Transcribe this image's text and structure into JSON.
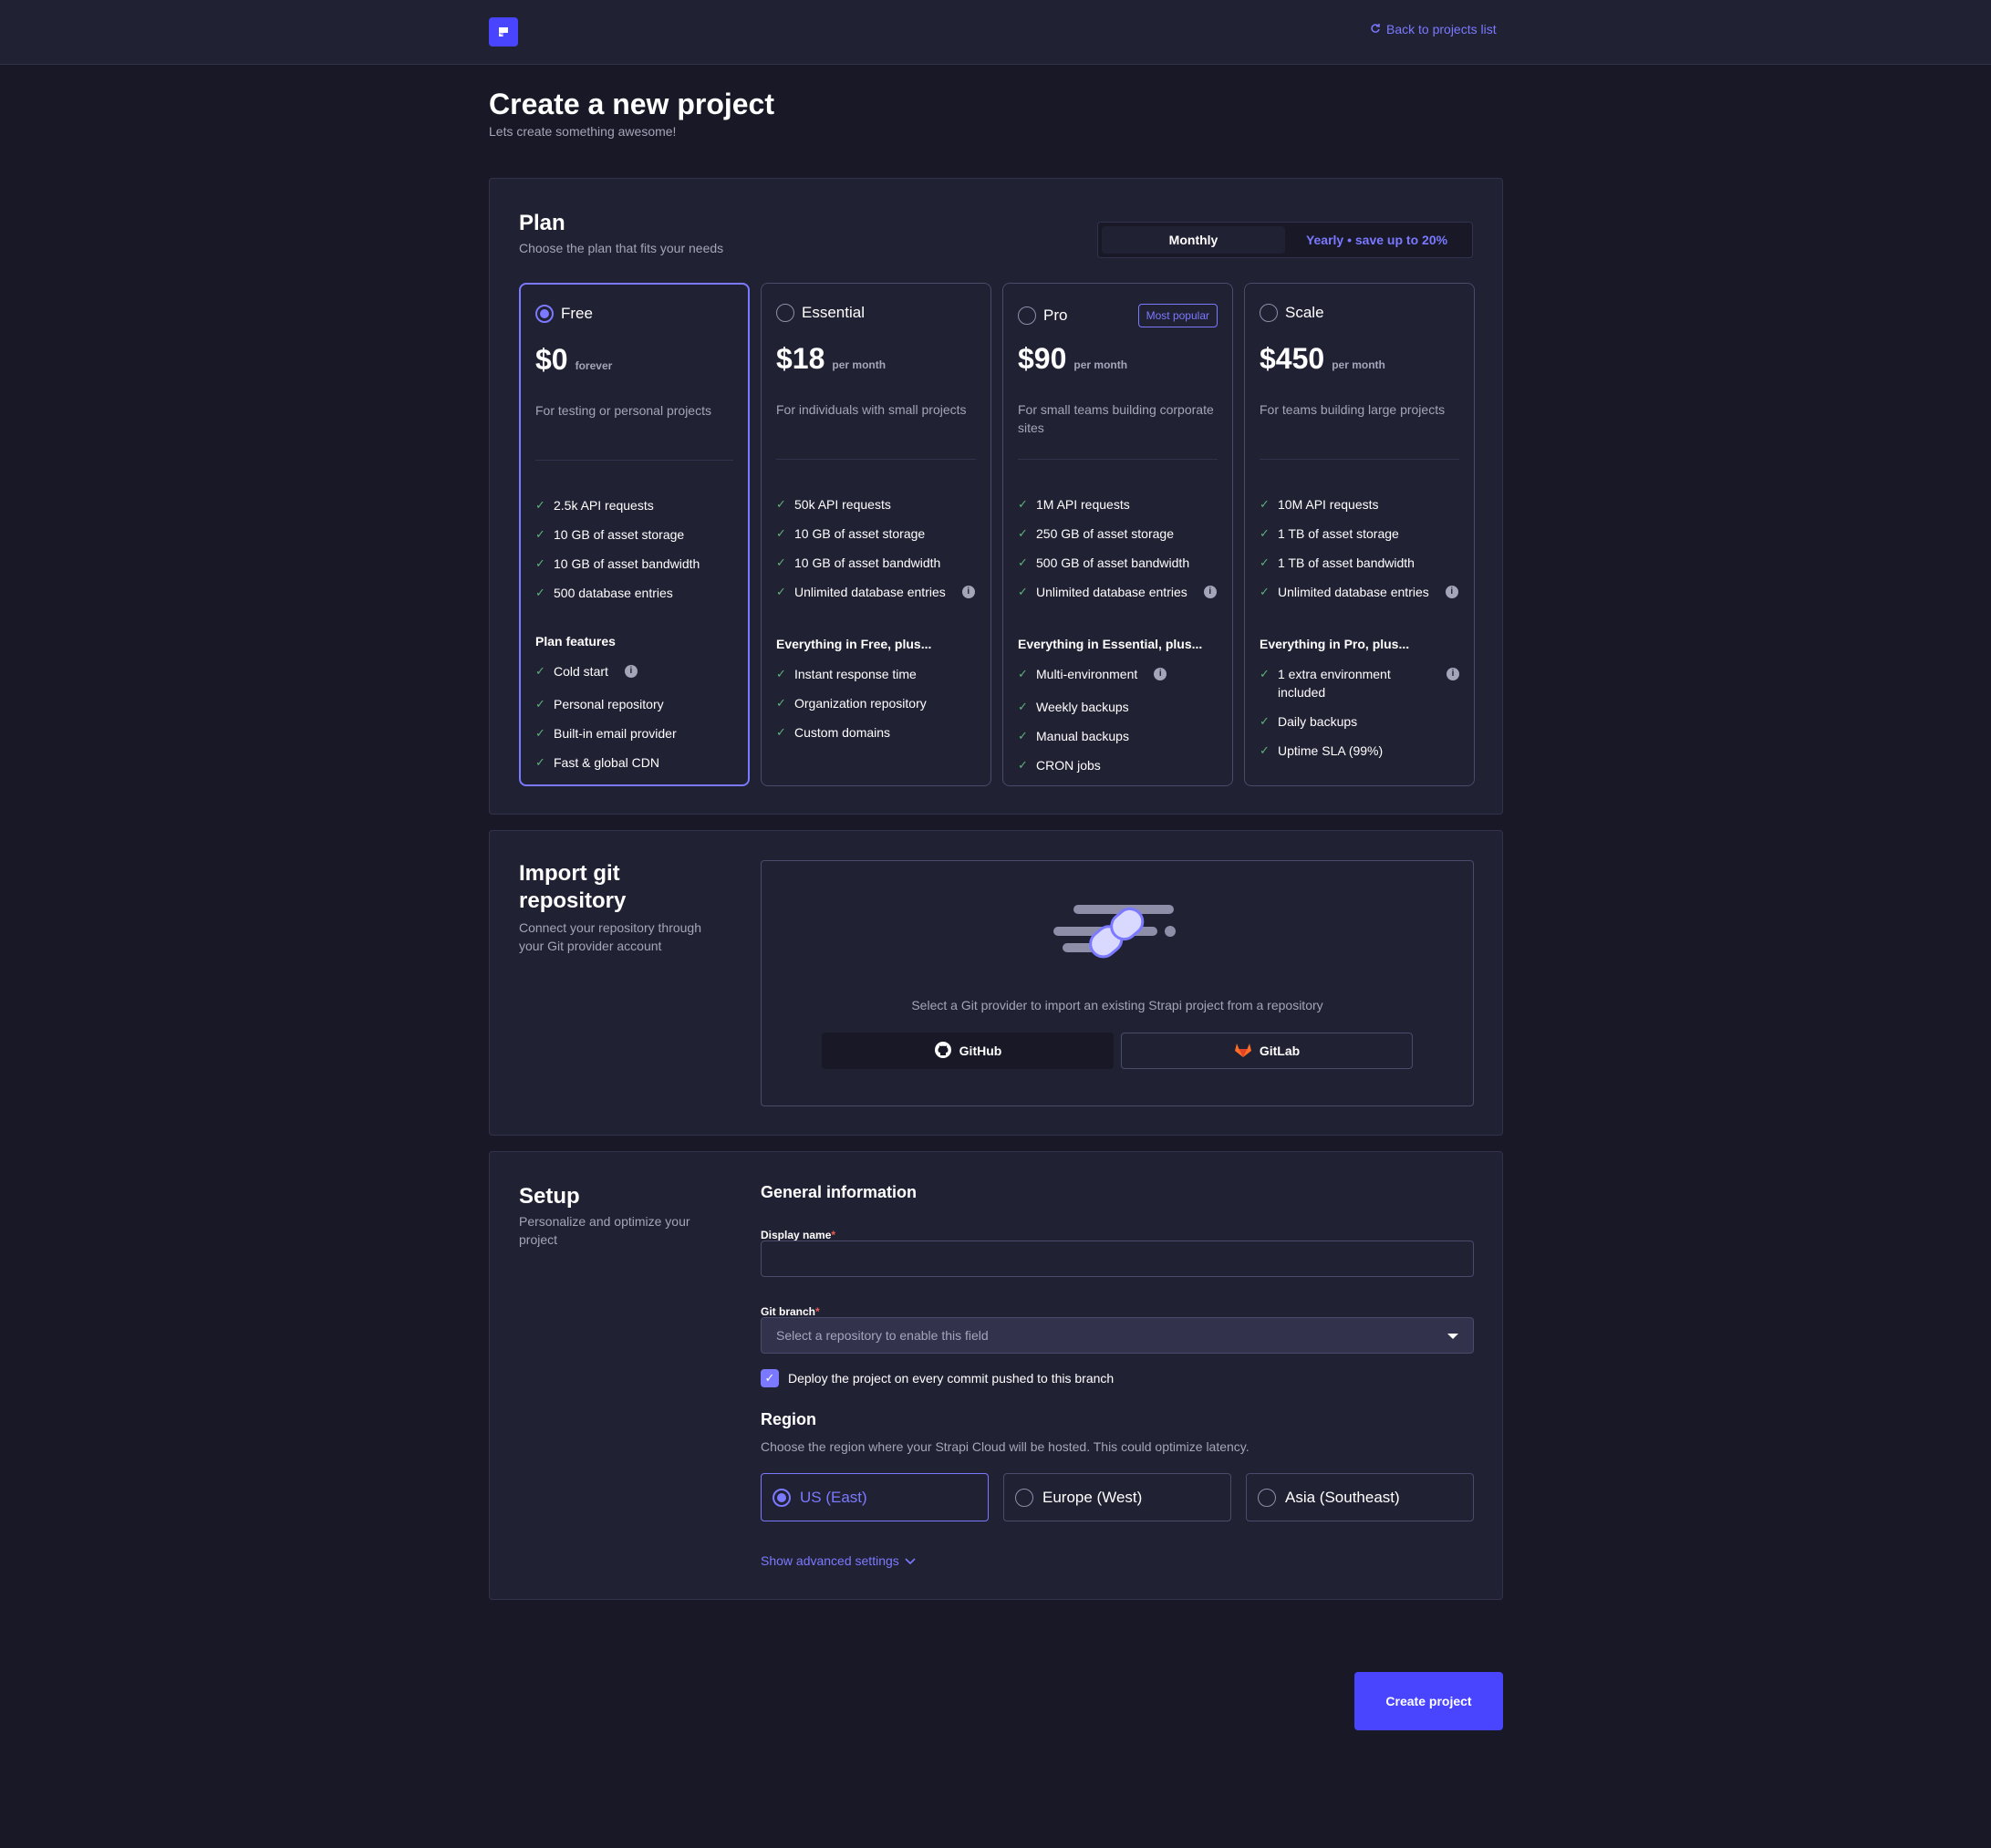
{
  "header": {
    "back_label": "Back to projects list"
  },
  "page": {
    "title": "Create a new project",
    "subtitle": "Lets create something awesome!"
  },
  "plan_section": {
    "title": "Plan",
    "description": "Choose the plan that fits your needs",
    "billing": {
      "monthly": "Monthly",
      "yearly": "Yearly • save up to 20%",
      "selected": "Monthly"
    },
    "plans": [
      {
        "name": "Free",
        "price": "$0",
        "period": "forever",
        "description": "For testing or personal projects",
        "selected": true,
        "features": [
          "2.5k API requests",
          "10 GB of asset storage",
          "10 GB of asset bandwidth",
          "500 database entries"
        ],
        "extra_title": "Plan features",
        "extras": [
          "Cold start",
          "Personal repository",
          "Built-in email provider",
          "Fast & global CDN"
        ]
      },
      {
        "name": "Essential",
        "price": "$18",
        "period": "per month",
        "description": "For individuals with small projects",
        "selected": false,
        "features": [
          "50k API requests",
          "10 GB of asset storage",
          "10 GB of asset bandwidth",
          "Unlimited database entries"
        ],
        "extra_title": "Everything in Free, plus...",
        "extras": [
          "Instant response time",
          "Organization repository",
          "Custom domains"
        ]
      },
      {
        "name": "Pro",
        "price": "$90",
        "period": "per month",
        "badge": "Most popular",
        "description": "For small teams building corporate sites",
        "selected": false,
        "features": [
          "1M API requests",
          "250 GB of asset storage",
          "500 GB of asset bandwidth",
          "Unlimited database entries"
        ],
        "extra_title": "Everything in Essential, plus...",
        "extras": [
          "Multi-environment",
          "Weekly backups",
          "Manual backups",
          "CRON jobs"
        ]
      },
      {
        "name": "Scale",
        "price": "$450",
        "period": "per month",
        "description": "For teams building large projects",
        "selected": false,
        "features": [
          "10M API requests",
          "1 TB of asset storage",
          "1 TB of asset bandwidth",
          "Unlimited database entries"
        ],
        "extra_title": "Everything in Pro, plus...",
        "extras": [
          "1 extra environment included",
          "Daily backups",
          "Uptime SLA (99%)"
        ]
      }
    ]
  },
  "git_section": {
    "title": "Import git repository",
    "description": "Connect your repository through your Git provider account",
    "prompt": "Select a Git provider to import an existing Strapi project from a repository",
    "github_label": "GitHub",
    "gitlab_label": "GitLab"
  },
  "setup_section": {
    "title": "Setup",
    "description": "Personalize and optimize your project",
    "general_heading": "General information",
    "display_name_label": "Display name",
    "display_name_value": "",
    "git_branch_label": "Git branch",
    "git_branch_placeholder": "Select a repository to enable this field",
    "deploy_checkbox_label": "Deploy the project on every commit pushed to this branch",
    "deploy_checked": true,
    "region_heading": "Region",
    "region_description": "Choose the region where your Strapi Cloud will be hosted. This could optimize latency.",
    "regions": [
      {
        "label": "US (East)",
        "selected": true
      },
      {
        "label": "Europe (West)",
        "selected": false
      },
      {
        "label": "Asia (Southeast)",
        "selected": false
      }
    ],
    "advanced_label": "Show advanced settings"
  },
  "actions": {
    "create_label": "Create project"
  },
  "colors": {
    "accent": "#7b79ff",
    "primary_button": "#4945ff",
    "background": "#181826",
    "panel": "#212134",
    "check": "#5cb176"
  }
}
